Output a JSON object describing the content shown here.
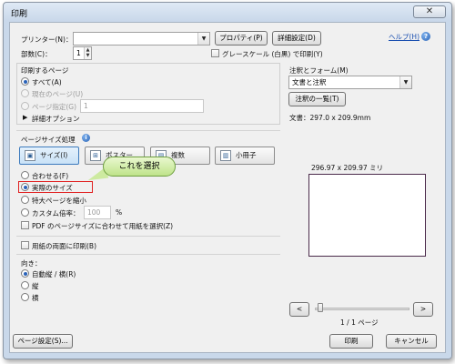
{
  "window": {
    "title": "印刷",
    "close_glyph": "✕"
  },
  "printer": {
    "label": "プリンター(N)：",
    "value": "",
    "properties_button": "プロパティ(P)",
    "advanced_button": "詳細設定(D)",
    "help_link": "ヘルプ(H)",
    "copies_label": "部数(C)：",
    "copies_value": "1",
    "grayscale_label": "グレースケール (白黒) で印刷(Y)"
  },
  "pages_to_print": {
    "heading": "印刷するページ",
    "all": "すべて(A)",
    "current": "現在のページ(U)",
    "range_label": "ページ指定(G)",
    "range_value": "1",
    "more_options": "詳細オプション"
  },
  "page_handling": {
    "heading": "ページサイズ処理",
    "buttons": {
      "size": "サイズ(I)",
      "poster": "ポスター",
      "multiple": "複数",
      "booklet": "小冊子"
    },
    "fit": "合わせる(F)",
    "actual_size": "実際のサイズ",
    "shrink": "特大ページを縮小",
    "custom_scale": "カスタム倍率：",
    "custom_value": "100",
    "percent": "%",
    "choose_source": "PDF のページサイズに合わせて用紙を選択(Z)",
    "callout": "これを選択"
  },
  "duplex": {
    "label": "用紙の両面に印刷(B)"
  },
  "orientation": {
    "heading": "向き：",
    "auto": "自動縦 / 横(R)",
    "portrait": "縦",
    "landscape": "横"
  },
  "comments_forms": {
    "heading": "注釈とフォーム(M)",
    "value": "文書と注釈",
    "summarize_button": "注釈の一覧(T)"
  },
  "preview": {
    "doc_size": "文書：297.0 x 209.9mm",
    "page_size": "296.97 x 209.97 ミリ",
    "prev": "<",
    "next": ">",
    "page_counter": "1 / 1 ページ"
  },
  "footer": {
    "page_setup": "ページ設定(S)...",
    "print": "印刷",
    "cancel": "キャンセル"
  },
  "icons": {
    "size": "size-page-icon",
    "poster": "poster-icon",
    "multiple": "multiple-pages-icon",
    "booklet": "booklet-icon",
    "help": "help-icon",
    "expand": "triangle-right-icon"
  },
  "colors": {
    "highlight": "#e02020",
    "callout": "#cdeaa0",
    "link": "#1a4fb0"
  }
}
